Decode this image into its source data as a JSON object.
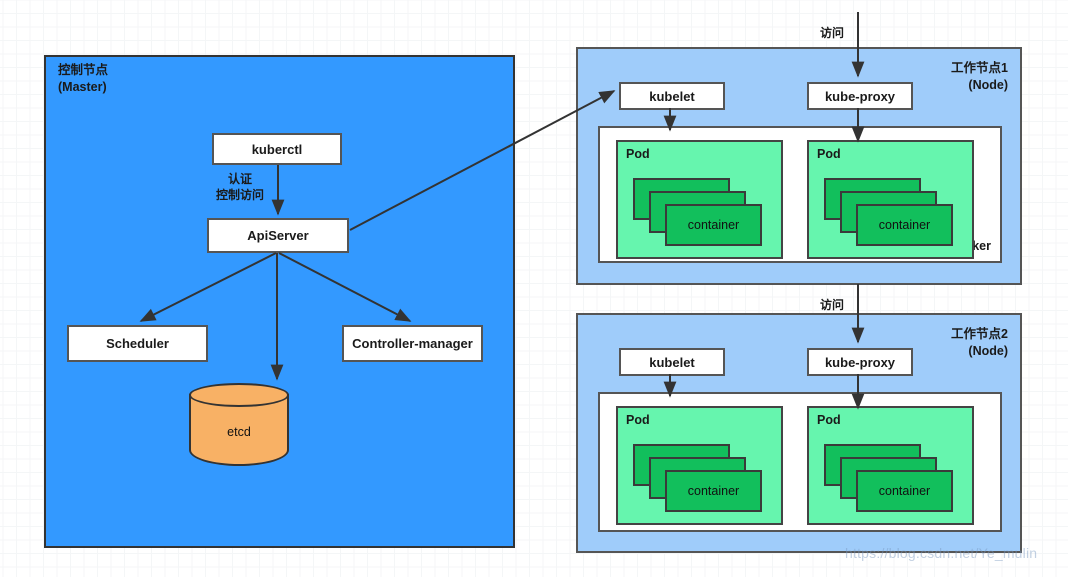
{
  "master": {
    "label": "控制节点\n(Master)",
    "color": "#3399FF",
    "components": {
      "kuberctl": "kuberctl",
      "apiserver": "ApiServer",
      "scheduler": "Scheduler",
      "controller_manager": "Controller-manager",
      "etcd": "etcd"
    },
    "auth_label": "认证\n控制访问"
  },
  "nodes": [
    {
      "label": "工作节点1\n(Node)",
      "access_label": "访问",
      "kubelet": "kubelet",
      "kube_proxy": "kube-proxy",
      "docker_label": "Docker",
      "pods": [
        {
          "label": "Pod",
          "container_label": "container"
        },
        {
          "label": "Pod",
          "container_label": "container"
        }
      ]
    },
    {
      "label": "工作节点2\n(Node)",
      "access_label": "访问",
      "kubelet": "kubelet",
      "kube_proxy": "kube-proxy",
      "docker_label": "",
      "pods": [
        {
          "label": "Pod",
          "container_label": "container"
        },
        {
          "label": "Pod",
          "container_label": "container"
        }
      ]
    }
  ],
  "colors": {
    "master_blue": "#3399FF",
    "node_blue": "#9FCCFA",
    "pod_green": "#66F5AE",
    "container_green": "#12BF5C",
    "etcd_orange": "#F8B165",
    "stroke": "#333333"
  },
  "watermark": "https://blog.csdn.net/Ye_mulin"
}
